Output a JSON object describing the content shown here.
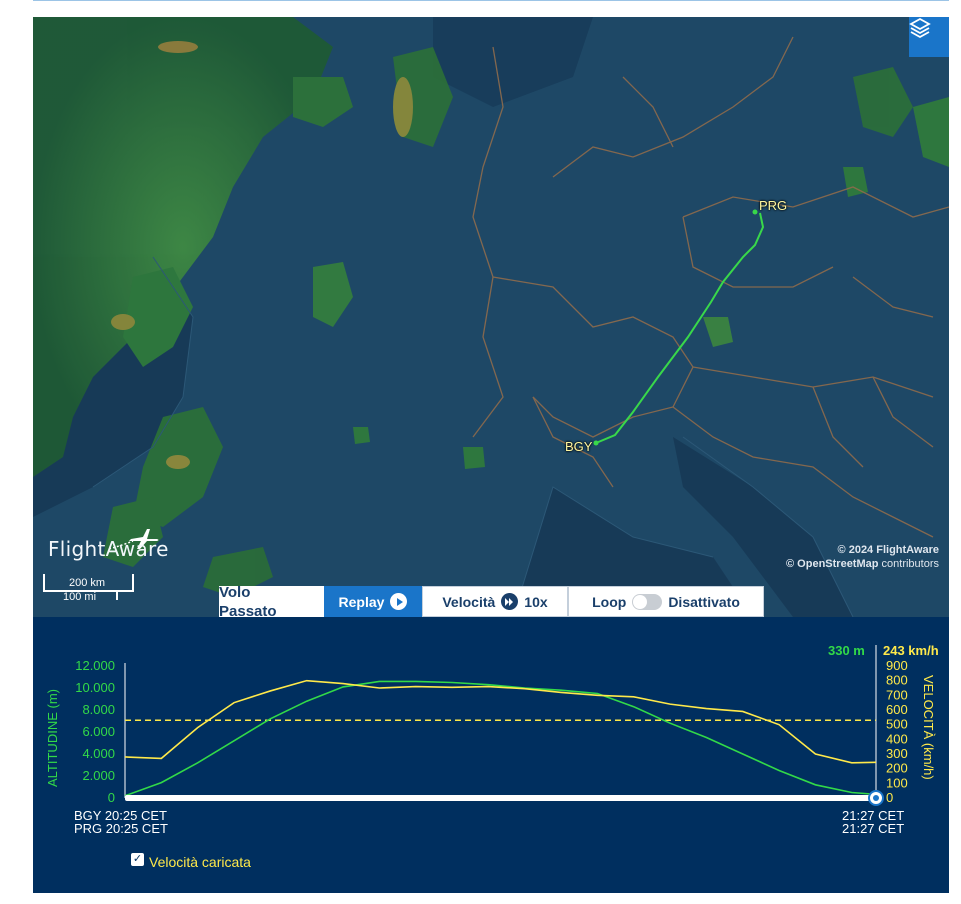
{
  "map": {
    "layers_icon": "layers-icon",
    "airports": [
      {
        "code": "PRG"
      },
      {
        "code": "BGY"
      }
    ],
    "brand": "FlightAware",
    "copyright_line1": "© 2024 FlightAware",
    "copyright_osm": "© OpenStreetMap",
    "copyright_contrib": " contributors",
    "scale_km": "200 km",
    "scale_mi": "100 mi"
  },
  "controls": {
    "title_line1": "Volo",
    "title_line2": "Passato",
    "replay_label": "Replay",
    "replay_icon": "play-icon",
    "speed_label": "Velocità",
    "speed_icon": "fast-forward-icon",
    "speed_value": "10x",
    "loop_label": "Loop",
    "loop_state": "Disattivato"
  },
  "graph": {
    "altitude_axis_label": "ALTITUDINE (m)",
    "speed_axis_label": "VELOCITÀ (km/h)",
    "altitude_ticks": [
      "12.000",
      "10.000",
      "8.000",
      "6.000",
      "4.000",
      "2.000",
      "0"
    ],
    "speed_ticks": [
      "900",
      "800",
      "700",
      "600",
      "500",
      "400",
      "300",
      "200",
      "100",
      "0"
    ],
    "current_altitude": "330 m",
    "current_speed": "243 km/h",
    "start_time_bgy": "BGY 20:25 CET",
    "start_time_prg": "PRG 20:25 CET",
    "end_time_1": "21:27 CET",
    "end_time_2": "21:27 CET",
    "checkbox_label": "Velocità caricata",
    "colors": {
      "altitude": "#32d948",
      "speed": "#ffe94a",
      "background": "#002f5f"
    }
  },
  "chart_data": {
    "type": "line",
    "x_label": "",
    "x": [
      0,
      3,
      6,
      9,
      12,
      15,
      18,
      21,
      24,
      27,
      30,
      33,
      36,
      39,
      42,
      45,
      48,
      51,
      54,
      57,
      60,
      62
    ],
    "series": [
      {
        "name": "ALTITUDINE (m)",
        "unit": "m",
        "values": [
          200,
          1400,
          3200,
          5200,
          7200,
          8800,
          10100,
          10600,
          10600,
          10500,
          10300,
          10000,
          9800,
          9500,
          8300,
          6800,
          5500,
          4000,
          2500,
          1200,
          500,
          330
        ]
      },
      {
        "name": "VELOCITÀ (km/h)",
        "unit": "km/h",
        "values": [
          280,
          270,
          480,
          650,
          730,
          800,
          780,
          750,
          760,
          755,
          760,
          745,
          720,
          700,
          690,
          640,
          610,
          590,
          500,
          300,
          240,
          243
        ]
      }
    ],
    "altitude_range": [
      0,
      12000
    ],
    "speed_range": [
      0,
      900
    ],
    "speed_reference_dashed": 530
  }
}
